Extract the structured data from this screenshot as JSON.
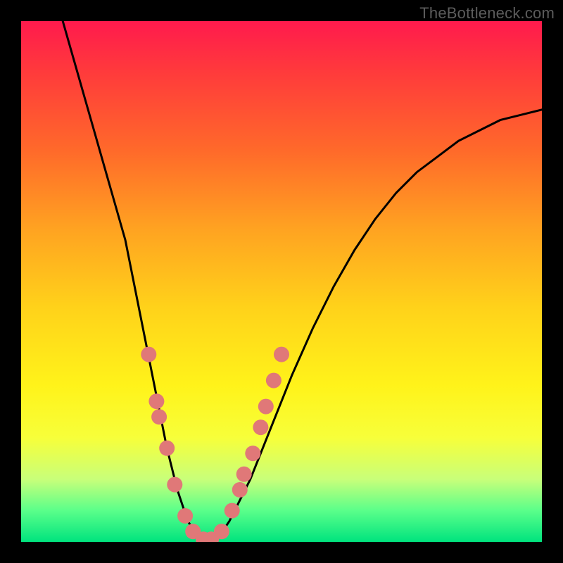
{
  "watermark": {
    "text": "TheBottleneck.com"
  },
  "chart_data": {
    "type": "line",
    "title": "",
    "xlabel": "",
    "ylabel": "",
    "xlim": [
      0,
      100
    ],
    "ylim": [
      0,
      100
    ],
    "series": [
      {
        "name": "bottleneck-curve",
        "x": [
          8,
          10,
          12,
          14,
          16,
          18,
          20,
          22,
          24,
          26,
          28,
          30,
          32,
          34,
          36,
          38,
          40,
          44,
          48,
          52,
          56,
          60,
          64,
          68,
          72,
          76,
          80,
          84,
          88,
          92,
          96,
          100
        ],
        "y": [
          100,
          93,
          86,
          79,
          72,
          65,
          58,
          48,
          38,
          28,
          18,
          10,
          4,
          1,
          0,
          1,
          4,
          12,
          22,
          32,
          41,
          49,
          56,
          62,
          67,
          71,
          74,
          77,
          79,
          81,
          82,
          83
        ]
      }
    ],
    "markers": [
      {
        "x": 24.5,
        "y": 36
      },
      {
        "x": 26.0,
        "y": 27
      },
      {
        "x": 26.5,
        "y": 24
      },
      {
        "x": 28.0,
        "y": 18
      },
      {
        "x": 29.5,
        "y": 11
      },
      {
        "x": 31.5,
        "y": 5
      },
      {
        "x": 33.0,
        "y": 2
      },
      {
        "x": 35.0,
        "y": 0.5
      },
      {
        "x": 36.5,
        "y": 0.5
      },
      {
        "x": 38.5,
        "y": 2
      },
      {
        "x": 40.5,
        "y": 6
      },
      {
        "x": 42.0,
        "y": 10
      },
      {
        "x": 42.8,
        "y": 13
      },
      {
        "x": 44.5,
        "y": 17
      },
      {
        "x": 46.0,
        "y": 22
      },
      {
        "x": 47.0,
        "y": 26
      },
      {
        "x": 48.5,
        "y": 31
      },
      {
        "x": 50.0,
        "y": 36
      }
    ],
    "band": {
      "y_start": 15,
      "y_end": 0,
      "desc": "green-good-zone"
    }
  }
}
